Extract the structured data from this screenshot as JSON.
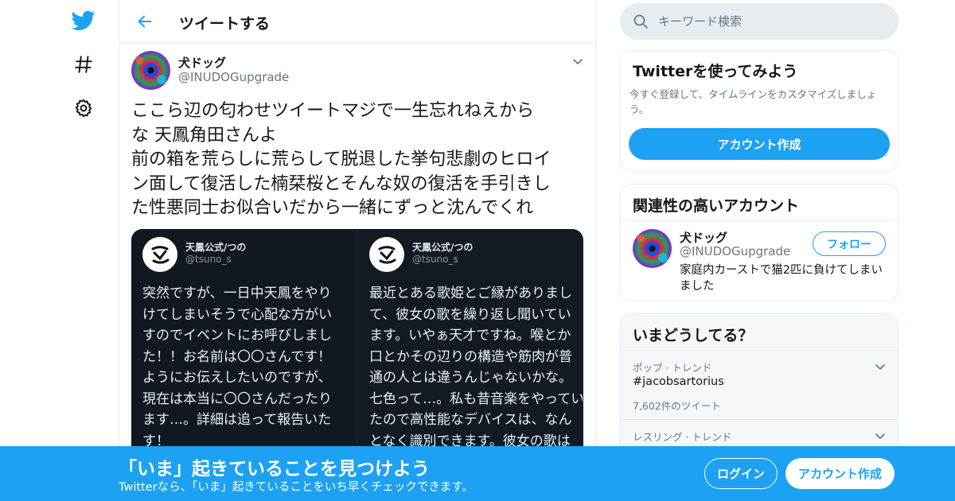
{
  "colors": {
    "accent": "#1da1f2",
    "text": "#14171a",
    "muted": "#657786",
    "border": "#e6ecf0",
    "banner": "#1da1f2"
  },
  "nav": {
    "items": [
      {
        "icon": "twitter-bird-icon"
      },
      {
        "icon": "hashtag-icon"
      },
      {
        "icon": "gear-icon"
      }
    ]
  },
  "header": {
    "back_icon": "back-arrow-icon",
    "title": "ツイートする"
  },
  "tweet": {
    "author_name": "犬ドッグ",
    "author_handle": "@INUDOGupgrade",
    "text_lines": [
      "ここら辺の匂わせツイートマジで一生忘れねえから",
      "な 天鳳角田さんよ",
      "前の箱を荒らしに荒らして脱退した挙句悲劇のヒロイ",
      "ン面して復活した楠栞桜とそんな奴の復活を手引きし",
      "た性悪同士お似合いだから一緒にずっと沈んでくれ"
    ],
    "media": [
      {
        "account_name": "天鳳公式/つの",
        "account_handle": "@tsuno_s",
        "text": "突然ですが、一日中天鳳をやり\nけてしまいそうで心配な方がい\nすのでイベントにお呼びしまし\nた！！お名前は〇〇さんです！\nようにお伝えしたいのですが、\n現在は本当に〇〇さんだったり\nます…。詳細は追って報告いた\nす！"
      },
      {
        "account_name": "天鳳公式/つの",
        "account_handle": "@tsuno_s",
        "text": "最近とある歌姫とご縁がありまし\nて、彼女の歌を繰り返し聞いてい\nます。いやぁ天才ですね。喉とか\n口とかその辺りの構造や筋肉が普\n通の人とは違うんじゃないかな。\n七色って…。私も昔音楽をやってい\nたので高性能なデバイスは、なん\nとなく識別できます。彼女の歌は\nもっと聞いてみたいなぁ…"
      }
    ]
  },
  "search": {
    "placeholder": "キーワード検索"
  },
  "try_card": {
    "title": "Twitterを使ってみよう",
    "description": "今すぐ登録して、タイムラインをカスタマイズしましょう。",
    "button": "アカウント作成"
  },
  "related": {
    "title": "関連性の高いアカウント",
    "name": "犬ドッグ",
    "handle": "@INUDOGupgrade",
    "follow": "フォロー",
    "bio": "家庭内カーストで猫2匹に負けてしまいました"
  },
  "trends": {
    "title": "いまどうしてる？",
    "items": [
      {
        "meta": "ポップ · トレンド",
        "name": "#jacobsartorius",
        "count": "7,602件のツイート"
      },
      {
        "meta": "レスリング · トレンド",
        "name": "",
        "count": ""
      }
    ]
  },
  "banner": {
    "title": "「いま」起きていることを見つけよう",
    "subtitle": "Twitterなら、「いま」起きていることをいち早くチェックできます。",
    "login": "ログイン",
    "signup": "アカウント作成"
  }
}
